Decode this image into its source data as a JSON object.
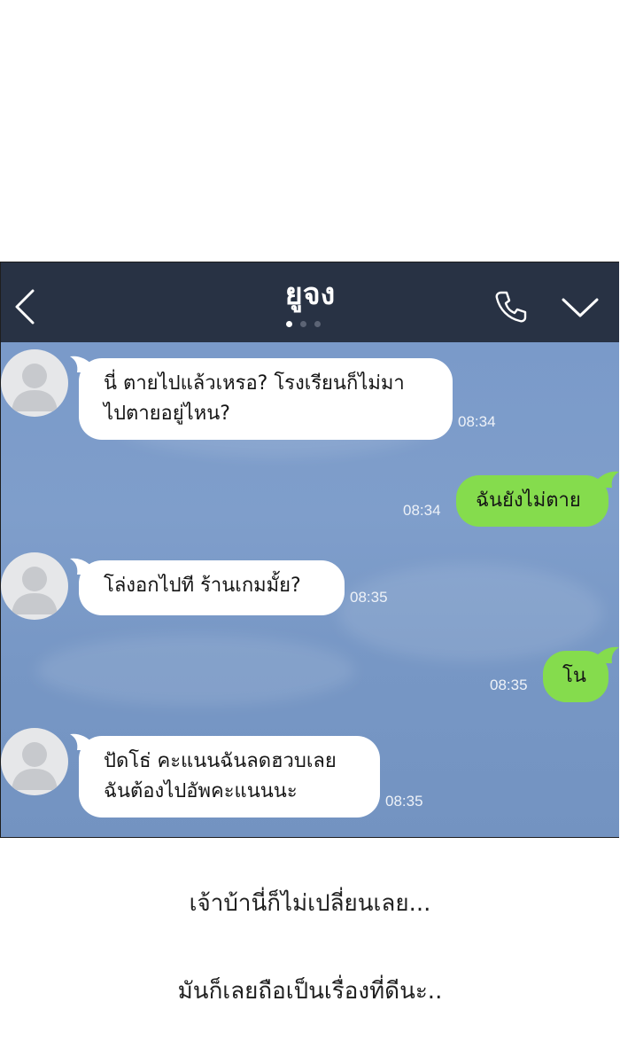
{
  "header": {
    "title": "ยูจง",
    "page_dots": 3,
    "active_dot": 0
  },
  "messages": [
    {
      "side": "in",
      "lines": [
        "นี่ ตายไปแล้วเหรอ? โรงเรียนก็ไม่มา",
        "ไปตายอยู่ไหน?"
      ],
      "time": "08:34"
    },
    {
      "side": "out",
      "lines": [
        "ฉันยังไม่ตาย"
      ],
      "time": "08:34"
    },
    {
      "side": "in",
      "lines": [
        "โล่งอกไปที ร้านเกมมั้ย?"
      ],
      "time": "08:35"
    },
    {
      "side": "out",
      "lines": [
        "โน"
      ],
      "time": "08:35"
    },
    {
      "side": "in",
      "lines": [
        "ปัดโธ่ คะแนนฉันลดฮวบเลย",
        "ฉันต้องไปอัพคะแนนนะ"
      ],
      "time": "08:35"
    }
  ],
  "captions": [
    "เจ้าบ้านี่ก็ไม่เปลี่ยนเลย...",
    "มันก็เลยถือเป็นเรื่องที่ดีนะ.."
  ],
  "colors": {
    "header_bg": "#283244",
    "chat_bg": "#7c9bc7",
    "incoming_bubble": "#ffffff",
    "outgoing_bubble": "#85dc4d"
  }
}
